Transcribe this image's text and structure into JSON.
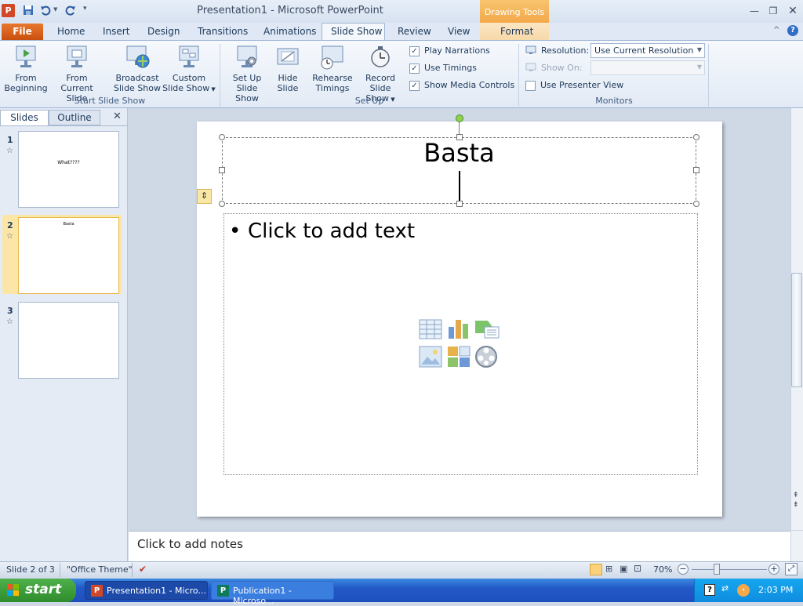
{
  "window": {
    "title": "Presentation1 - Microsoft PowerPoint",
    "contextual_tab_group": "Drawing Tools"
  },
  "tabs": [
    "File",
    "Home",
    "Insert",
    "Design",
    "Transitions",
    "Animations",
    "Slide Show",
    "Review",
    "View",
    "Format"
  ],
  "ribbon": {
    "groups": {
      "start_slide_show": "Start Slide Show",
      "set_up": "Set Up",
      "monitors": "Monitors"
    },
    "buttons": {
      "from_beginning": [
        "From",
        "Beginning"
      ],
      "from_current": [
        "From",
        "Current Slide"
      ],
      "broadcast": [
        "Broadcast",
        "Slide Show"
      ],
      "custom": [
        "Custom",
        "Slide Show"
      ],
      "setup_show": [
        "Set Up",
        "Slide Show"
      ],
      "hide_slide": [
        "Hide",
        "Slide"
      ],
      "rehearse": [
        "Rehearse",
        "Timings"
      ],
      "record": [
        "Record Slide",
        "Show"
      ]
    },
    "checkboxes": {
      "play_narrations": "Play Narrations",
      "use_timings": "Use Timings",
      "show_media_controls": "Show Media Controls",
      "use_presenter_view": "Use Presenter View"
    },
    "resolution_label": "Resolution:",
    "resolution_value": "Use Current Resolution",
    "show_on_label": "Show On:"
  },
  "pane": {
    "tab_slides": "Slides",
    "tab_outline": "Outline",
    "slides": [
      {
        "num": "1",
        "title": "What????"
      },
      {
        "num": "2",
        "title": "Basta"
      },
      {
        "num": "3",
        "title": ""
      }
    ]
  },
  "slide": {
    "title": "Basta",
    "body_placeholder": "Click to add text",
    "bullet": "•"
  },
  "notes_placeholder": "Click to add notes",
  "status": {
    "slide_counter": "Slide 2 of 3",
    "theme": "\"Office Theme\"",
    "zoom": "70%"
  },
  "taskbar": {
    "start": "start",
    "tasks": [
      "Presentation1 - Micro...",
      "Publication1 - Microso..."
    ],
    "clock": "2:03 PM"
  }
}
